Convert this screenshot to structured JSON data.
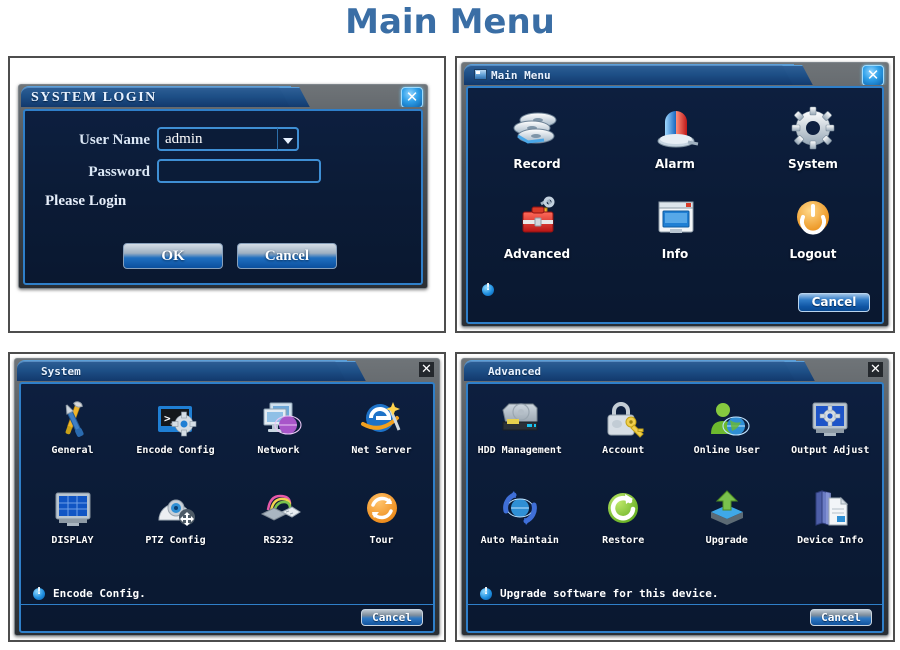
{
  "page": {
    "title": "Main Menu"
  },
  "login": {
    "title": "SYSTEM LOGIN",
    "close_icon": "close-icon",
    "fields": [
      {
        "label": "User Name",
        "value": "admin",
        "type": "dropdown",
        "name": "user-name"
      },
      {
        "label": "Password",
        "value": "",
        "type": "password",
        "name": "password"
      }
    ],
    "hint": "Please Login",
    "buttons": [
      {
        "label": "OK",
        "name": "ok"
      },
      {
        "label": "Cancel",
        "name": "cancel"
      }
    ]
  },
  "mainmenu": {
    "title": "Main Menu",
    "title_icon": "window-icon",
    "close_icon": "close-icon",
    "items": [
      {
        "label": "Record",
        "icon": "film-reel-icon"
      },
      {
        "label": "Alarm",
        "icon": "siren-light-icon"
      },
      {
        "label": "System",
        "icon": "gear-icon"
      },
      {
        "label": "Advanced",
        "icon": "toolbox-icon"
      },
      {
        "label": "Info",
        "icon": "monitor-window-icon"
      },
      {
        "label": "Logout",
        "icon": "power-icon"
      }
    ],
    "status_text": "",
    "cancel_label": "Cancel"
  },
  "system": {
    "title": "System",
    "close_icon": "close-icon",
    "items": [
      {
        "label": "General",
        "icon": "wrench-screwdriver-icon"
      },
      {
        "label": "Encode Config",
        "icon": "terminal-gear-icon"
      },
      {
        "label": "Network",
        "icon": "monitors-globe-icon"
      },
      {
        "label": "Net Server",
        "icon": "browser-wand-icon"
      },
      {
        "label": "DISPLAY",
        "icon": "grid-monitor-icon"
      },
      {
        "label": "PTZ Config",
        "icon": "dome-camera-move-icon"
      },
      {
        "label": "RS232",
        "icon": "cable-connector-icon"
      },
      {
        "label": "Tour",
        "icon": "refresh-circle-icon"
      }
    ],
    "status_text": "Encode Config.",
    "cancel_label": "Cancel"
  },
  "advanced": {
    "title": "Advanced",
    "close_icon": "close-icon",
    "items": [
      {
        "label": "HDD Management",
        "icon": "hard-disk-icon"
      },
      {
        "label": "Account",
        "icon": "padlock-key-icon"
      },
      {
        "label": "Online User",
        "icon": "user-globe-icon"
      },
      {
        "label": "Output Adjust",
        "icon": "monitor-gear-icon"
      },
      {
        "label": "Auto Maintain",
        "icon": "globe-arrows-icon"
      },
      {
        "label": "Restore",
        "icon": "restore-circle-icon"
      },
      {
        "label": "Upgrade",
        "icon": "upload-arrow-icon"
      },
      {
        "label": "Device Info",
        "icon": "book-document-icon"
      }
    ],
    "status_text": "Upgrade software for this device.",
    "cancel_label": "Cancel"
  },
  "colors": {
    "page_title": "#3a6ea5",
    "dialog_body": "#0b1b36",
    "dialog_border": "#2f7fc9",
    "tab_blue": "#1d4f86",
    "accent_orange": "#f2a01e",
    "accent_green": "#7ac143"
  }
}
